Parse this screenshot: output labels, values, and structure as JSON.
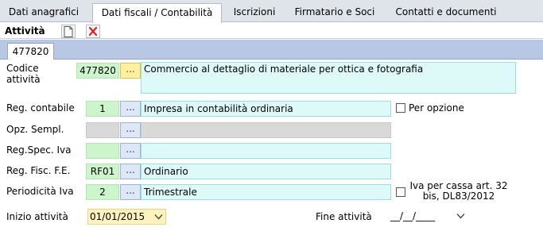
{
  "tabs": [
    {
      "label": "Dati anagrafici",
      "active": false
    },
    {
      "label": "Dati fiscali / Contabilità",
      "active": true
    },
    {
      "label": "Iscrizioni",
      "active": false
    },
    {
      "label": "Firmatario e Soci",
      "active": false
    },
    {
      "label": "Contatti e documenti",
      "active": false
    }
  ],
  "section": {
    "title": "Attività",
    "new_icon": "document-new-icon",
    "delete_icon": "delete-x-icon"
  },
  "subtab": {
    "label": "477820"
  },
  "form": {
    "codice": {
      "label": "Codice attività",
      "code": "477820",
      "button": "...",
      "description": "Commercio al dettaglio di materiale per ottica e fotografia"
    },
    "reg_contabile": {
      "label": "Reg. contabile",
      "code": "1",
      "button": "...",
      "description": "Impresa  in contabilità ordinaria",
      "option_label": "Per opzione",
      "option_checked": false
    },
    "opz_sempl": {
      "label": "Opz. Sempl.",
      "code": "",
      "button": "...",
      "description": ""
    },
    "reg_spec_iva": {
      "label": "Reg.Spec. Iva",
      "code": "",
      "button": "...",
      "description": ""
    },
    "reg_fisc": {
      "label": "Reg. Fisc. F.E.",
      "code": "RF01",
      "button": "...",
      "description": "Ordinario"
    },
    "periodicita": {
      "label": "Periodicità Iva",
      "code": "2",
      "button": "...",
      "description": "Trimestrale",
      "option_label_line1": "Iva per cassa art. 32",
      "option_label_line2": "bis, DL83/2012",
      "option_checked": false
    },
    "inizio": {
      "label": "Inizio attività",
      "value": "01/01/2015"
    },
    "fine": {
      "label": "Fine attività",
      "value": "__/__/____"
    }
  },
  "colors": {
    "code_green": "#ccf5cc",
    "desc_cyan": "#ddfaf8",
    "date_yellow": "#fff3bd",
    "subtab_blue": "#b8c8e4"
  }
}
